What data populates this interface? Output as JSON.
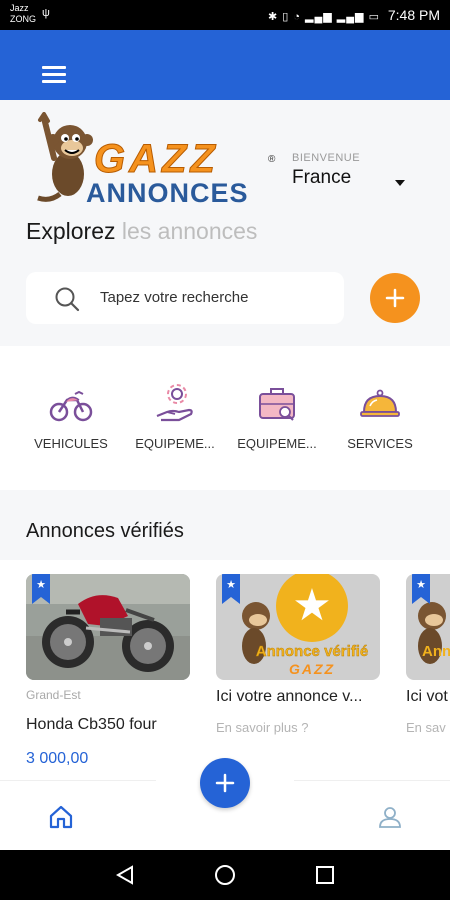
{
  "status_bar": {
    "carrier_line1": "Jazz",
    "carrier_line2": "ZONG",
    "time": "7:48 PM",
    "icons": [
      "usb-icon",
      "bluetooth-icon",
      "vibrate-icon",
      "wifi-icon",
      "signal-icon",
      "battery-icon"
    ]
  },
  "app_bar": {
    "menu_icon": "hamburger-icon",
    "color": "#2563d6"
  },
  "logo": {
    "line1": "GAZZ",
    "line2": "ANNONCES"
  },
  "location": {
    "welcome": "BIENVENUE",
    "country": "France"
  },
  "explore": {
    "strong": "Explorez",
    "light": "les annonces"
  },
  "search": {
    "placeholder": "Tapez votre recherche"
  },
  "categories": [
    {
      "label": "VEHICULES",
      "icon": "motorcycle-icon"
    },
    {
      "label": "EQUIPEME...",
      "icon": "hand-flower-icon"
    },
    {
      "label": "EQUIPEME...",
      "icon": "briefcase-icon"
    },
    {
      "label": "SERVICES",
      "icon": "service-bell-icon"
    }
  ],
  "verified": {
    "title": "Annonces vérifiés",
    "cards": [
      {
        "region": "Grand-Est",
        "title": "Honda Cb350 four",
        "price": "3 000,00"
      },
      {
        "title": "Ici votre annonce v...",
        "link": "En savoir plus ?",
        "badge_text": "Annonce vérifié",
        "badge_brand": "GAZZ"
      },
      {
        "title": "Ici vot",
        "link": "En sav",
        "badge_text": "Ann"
      }
    ]
  },
  "bottom_nav": {
    "home_icon": "home-icon",
    "profile_icon": "user-icon",
    "add_icon": "plus-icon"
  },
  "colors": {
    "primary": "#2563d6",
    "accent": "#f5921e"
  }
}
